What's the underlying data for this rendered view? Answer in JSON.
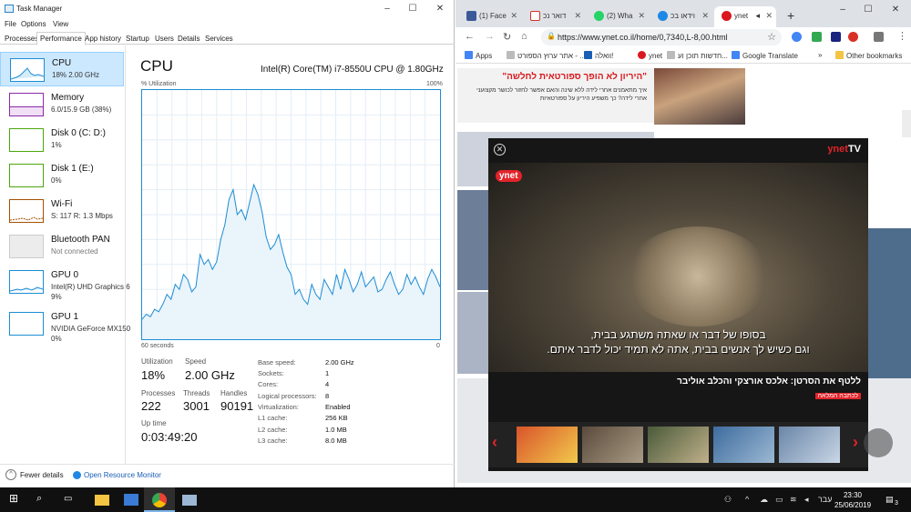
{
  "task_manager": {
    "title": "Task Manager",
    "menu": [
      "File",
      "Options",
      "View"
    ],
    "tabs": [
      "Processes",
      "Performance",
      "App history",
      "Startup",
      "Users",
      "Details",
      "Services"
    ],
    "sidebar": [
      {
        "name": "CPU",
        "sub": "18% 2.00 GHz",
        "sub2": ""
      },
      {
        "name": "Memory",
        "sub": "6.0/15.9 GB (38%)",
        "sub2": ""
      },
      {
        "name": "Disk 0 (C: D:)",
        "sub": "1%",
        "sub2": ""
      },
      {
        "name": "Disk 1 (E:)",
        "sub": "0%",
        "sub2": ""
      },
      {
        "name": "Wi-Fi",
        "sub": "S: 117 R: 1.3 Mbps",
        "sub2": ""
      },
      {
        "name": "Bluetooth PAN",
        "sub": "Not connected",
        "sub2": ""
      },
      {
        "name": "GPU 0",
        "sub": "Intel(R) UHD Graphics 6",
        "sub2": "9%"
      },
      {
        "name": "GPU 1",
        "sub": "NVIDIA GeForce MX150",
        "sub2": "0%"
      }
    ],
    "cpu_title": "CPU",
    "cpu_model": "Intel(R) Core(TM) i7-8550U CPU @ 1.80GHz",
    "util_label": "% Utilization",
    "pct_max": "100%",
    "time_span": "60 seconds",
    "zero": "0",
    "stats": {
      "utilization_label": "Utilization",
      "utilization": "18%",
      "speed_label": "Speed",
      "speed": "2.00 GHz",
      "processes_label": "Processes",
      "processes": "222",
      "threads_label": "Threads",
      "threads": "3001",
      "handles_label": "Handles",
      "handles": "90191",
      "uptime_label": "Up time",
      "uptime": "0:03:49:20"
    },
    "info": [
      {
        "label": "Base speed:",
        "value": "2.00 GHz"
      },
      {
        "label": "Sockets:",
        "value": "1"
      },
      {
        "label": "Cores:",
        "value": "4"
      },
      {
        "label": "Logical processors:",
        "value": "8"
      },
      {
        "label": "Virtualization:",
        "value": "Enabled"
      },
      {
        "label": "L1 cache:",
        "value": "256 KB"
      },
      {
        "label": "L2 cache:",
        "value": "1.0 MB"
      },
      {
        "label": "L3 cache:",
        "value": "8.0 MB"
      }
    ],
    "fewer_details": "Fewer details",
    "open_resource_monitor": "Open Resource Monitor",
    "graph_values": [
      8,
      10,
      9,
      12,
      11,
      14,
      18,
      16,
      22,
      20,
      26,
      24,
      19,
      21,
      34,
      30,
      32,
      28,
      31,
      40,
      46,
      56,
      60,
      50,
      52,
      48,
      55,
      62,
      58,
      51,
      41,
      36,
      38,
      42,
      35,
      29,
      26,
      18,
      20,
      16,
      14,
      22,
      18,
      16,
      24,
      21,
      18,
      26,
      20,
      28,
      24,
      19,
      22,
      27,
      21,
      23,
      25,
      19,
      20,
      24,
      27,
      22,
      18,
      20,
      26,
      22,
      25,
      21,
      18,
      24,
      28,
      25,
      21
    ]
  },
  "chrome": {
    "tabs": [
      {
        "label": "(1) Face",
        "color": "#3b5998"
      },
      {
        "label": "דואר נכ",
        "color": "#d93025"
      },
      {
        "label": "(2) Wha",
        "color": "#25d366"
      },
      {
        "label": "וידאו בכ",
        "color": "#1e88e5"
      },
      {
        "label": "ynet",
        "color": "#d9181d"
      }
    ],
    "url": "https://www.ynet.co.il/home/0,7340,L-8,00.html",
    "bookmarks": [
      "Apps",
      "אתר ערוץ הספורט - ...",
      "וואלה!",
      "חדשות תוכן וע...",
      "ynet",
      "Google Translate",
      "Other bookmarks"
    ],
    "banner_headline": "\"היריון לא הופך ספורטאית לחלשה\"",
    "banner_text": "איך מתאמנים אחרי לידה ללא שינה והאם אפשר לחזור לכושר מקצועני אחרי לידה? כך משפיע היריון על ספורטאיות",
    "video": {
      "brand": "ynet",
      "brand_tv": "TV",
      "logo": "ynet",
      "subtitle_1": "בסופו של דבר או שאתה משתגע בבית,",
      "subtitle_2": "וגם כשיש לך אנשים בבית, אתה לא תמיד יכול לדבר איתם.",
      "title": "ללטף את הסרטן: אלכס אורצקי והכלב אוליבר",
      "link": "לכתבה המלאה"
    }
  },
  "taskbar": {
    "language": "עבר",
    "time": "23:30",
    "date": "25/06/2019",
    "notifications": "3"
  }
}
